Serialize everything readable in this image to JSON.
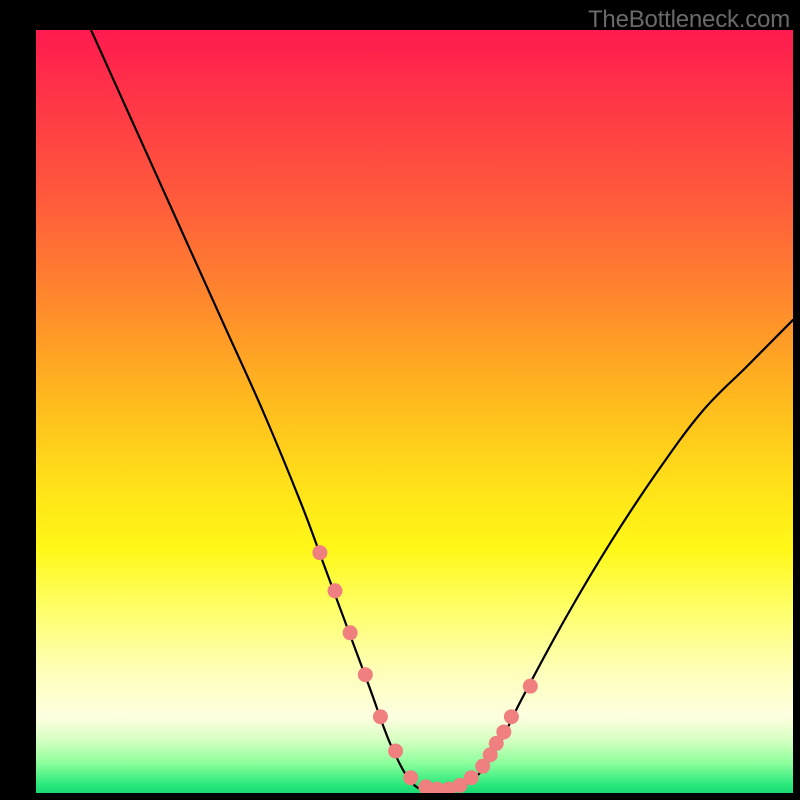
{
  "watermark": "TheBottleneck.com",
  "colors": {
    "bg": "#000000",
    "curve": "#000000",
    "dots": "#F08080"
  },
  "chart_data": {
    "type": "line",
    "title": "",
    "xlabel": "",
    "ylabel": "",
    "xlim": [
      0,
      100
    ],
    "ylim": [
      0,
      100
    ],
    "grid": false,
    "series": [
      {
        "name": "bottleneck-curve",
        "x": [
          5,
          10,
          15,
          20,
          25,
          30,
          35,
          38,
          41,
          44,
          47,
          50,
          53,
          55,
          58,
          61,
          64,
          70,
          76,
          82,
          88,
          94,
          100
        ],
        "values": [
          105,
          94,
          83,
          72,
          61,
          50,
          38,
          30,
          22,
          14,
          6,
          1,
          0.5,
          0.5,
          2,
          6,
          12,
          23,
          33,
          42,
          50,
          56,
          62
        ]
      }
    ],
    "markers": {
      "name": "highlight-dots",
      "x": [
        37.5,
        39.5,
        41.5,
        43.5,
        45.5,
        47.5,
        49.5,
        51.5,
        53.0,
        54.5,
        56.0,
        57.5,
        59.0,
        60.0,
        60.8,
        61.8,
        62.8,
        65.3
      ],
      "values": [
        31.5,
        26.5,
        21.0,
        15.5,
        10.0,
        5.5,
        2.0,
        0.8,
        0.5,
        0.5,
        1.0,
        2.0,
        3.5,
        5.0,
        6.5,
        8.0,
        10.0,
        14.0
      ]
    }
  }
}
